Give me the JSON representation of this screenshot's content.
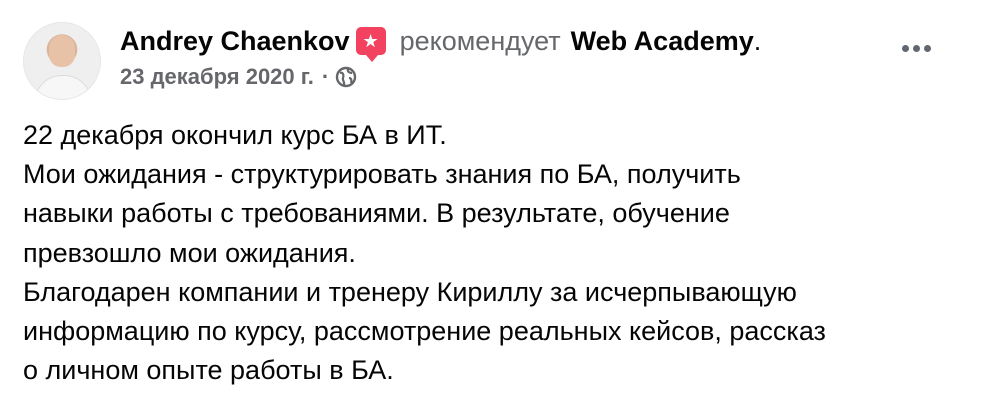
{
  "post": {
    "author": "Andrey Chaenkov",
    "action": "рекомендует",
    "page": "Web Academy",
    "page_suffix": ".",
    "date": "23 декабря 2020 г.",
    "separator": "·",
    "privacy_icon": "globe-icon",
    "recommend_icon": "recommend-badge-icon",
    "more_icon": "more-options-icon",
    "lines": [
      "22 декабря окончил курс БА в ИТ.",
      "Мои ожидания - структурировать знания по БА, получить",
      "навыки работы с требованиями. В результате, обучение",
      "превзошло мои ожидания.",
      "Благодарен компании и тренеру Кириллу за исчерпывающую",
      "информацию по курсу, рассмотрение реальных кейсов, рассказ",
      "о личном опыте работы в БА."
    ]
  },
  "colors": {
    "badge": "#f3425f",
    "muted": "#65676b",
    "text": "#050505"
  }
}
